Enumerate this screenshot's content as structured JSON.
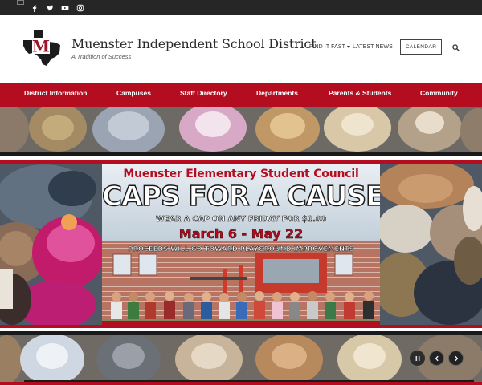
{
  "social": {
    "icons": [
      "facebook-icon",
      "twitter-icon",
      "youtube-icon",
      "instagram-icon"
    ]
  },
  "header": {
    "title": "Muenster Independent School District",
    "tagline": "A Tradition of Success",
    "find_it_fast": "FIND IT FAST",
    "latest_news": "LATEST NEWS",
    "calendar": "CALENDAR",
    "logo_letter": "M"
  },
  "nav": {
    "items": [
      "District Information",
      "Campuses",
      "Staff Directory",
      "Departments",
      "Parents & Students",
      "Community"
    ]
  },
  "slide": {
    "line1": "Muenster Elementary Student Council",
    "line2": "CAPS FOR A CAUSE",
    "line3": "WEAR A CAP ON ANY FRIDAY FOR $1.00",
    "line4": "March 6 - May 22",
    "line5": "PROCEEDS WILL GO TOWARD PLAYGROUND IMPROVEMENTS"
  },
  "colors": {
    "brand_red": "#b30d1f",
    "topbar": "#262626"
  }
}
